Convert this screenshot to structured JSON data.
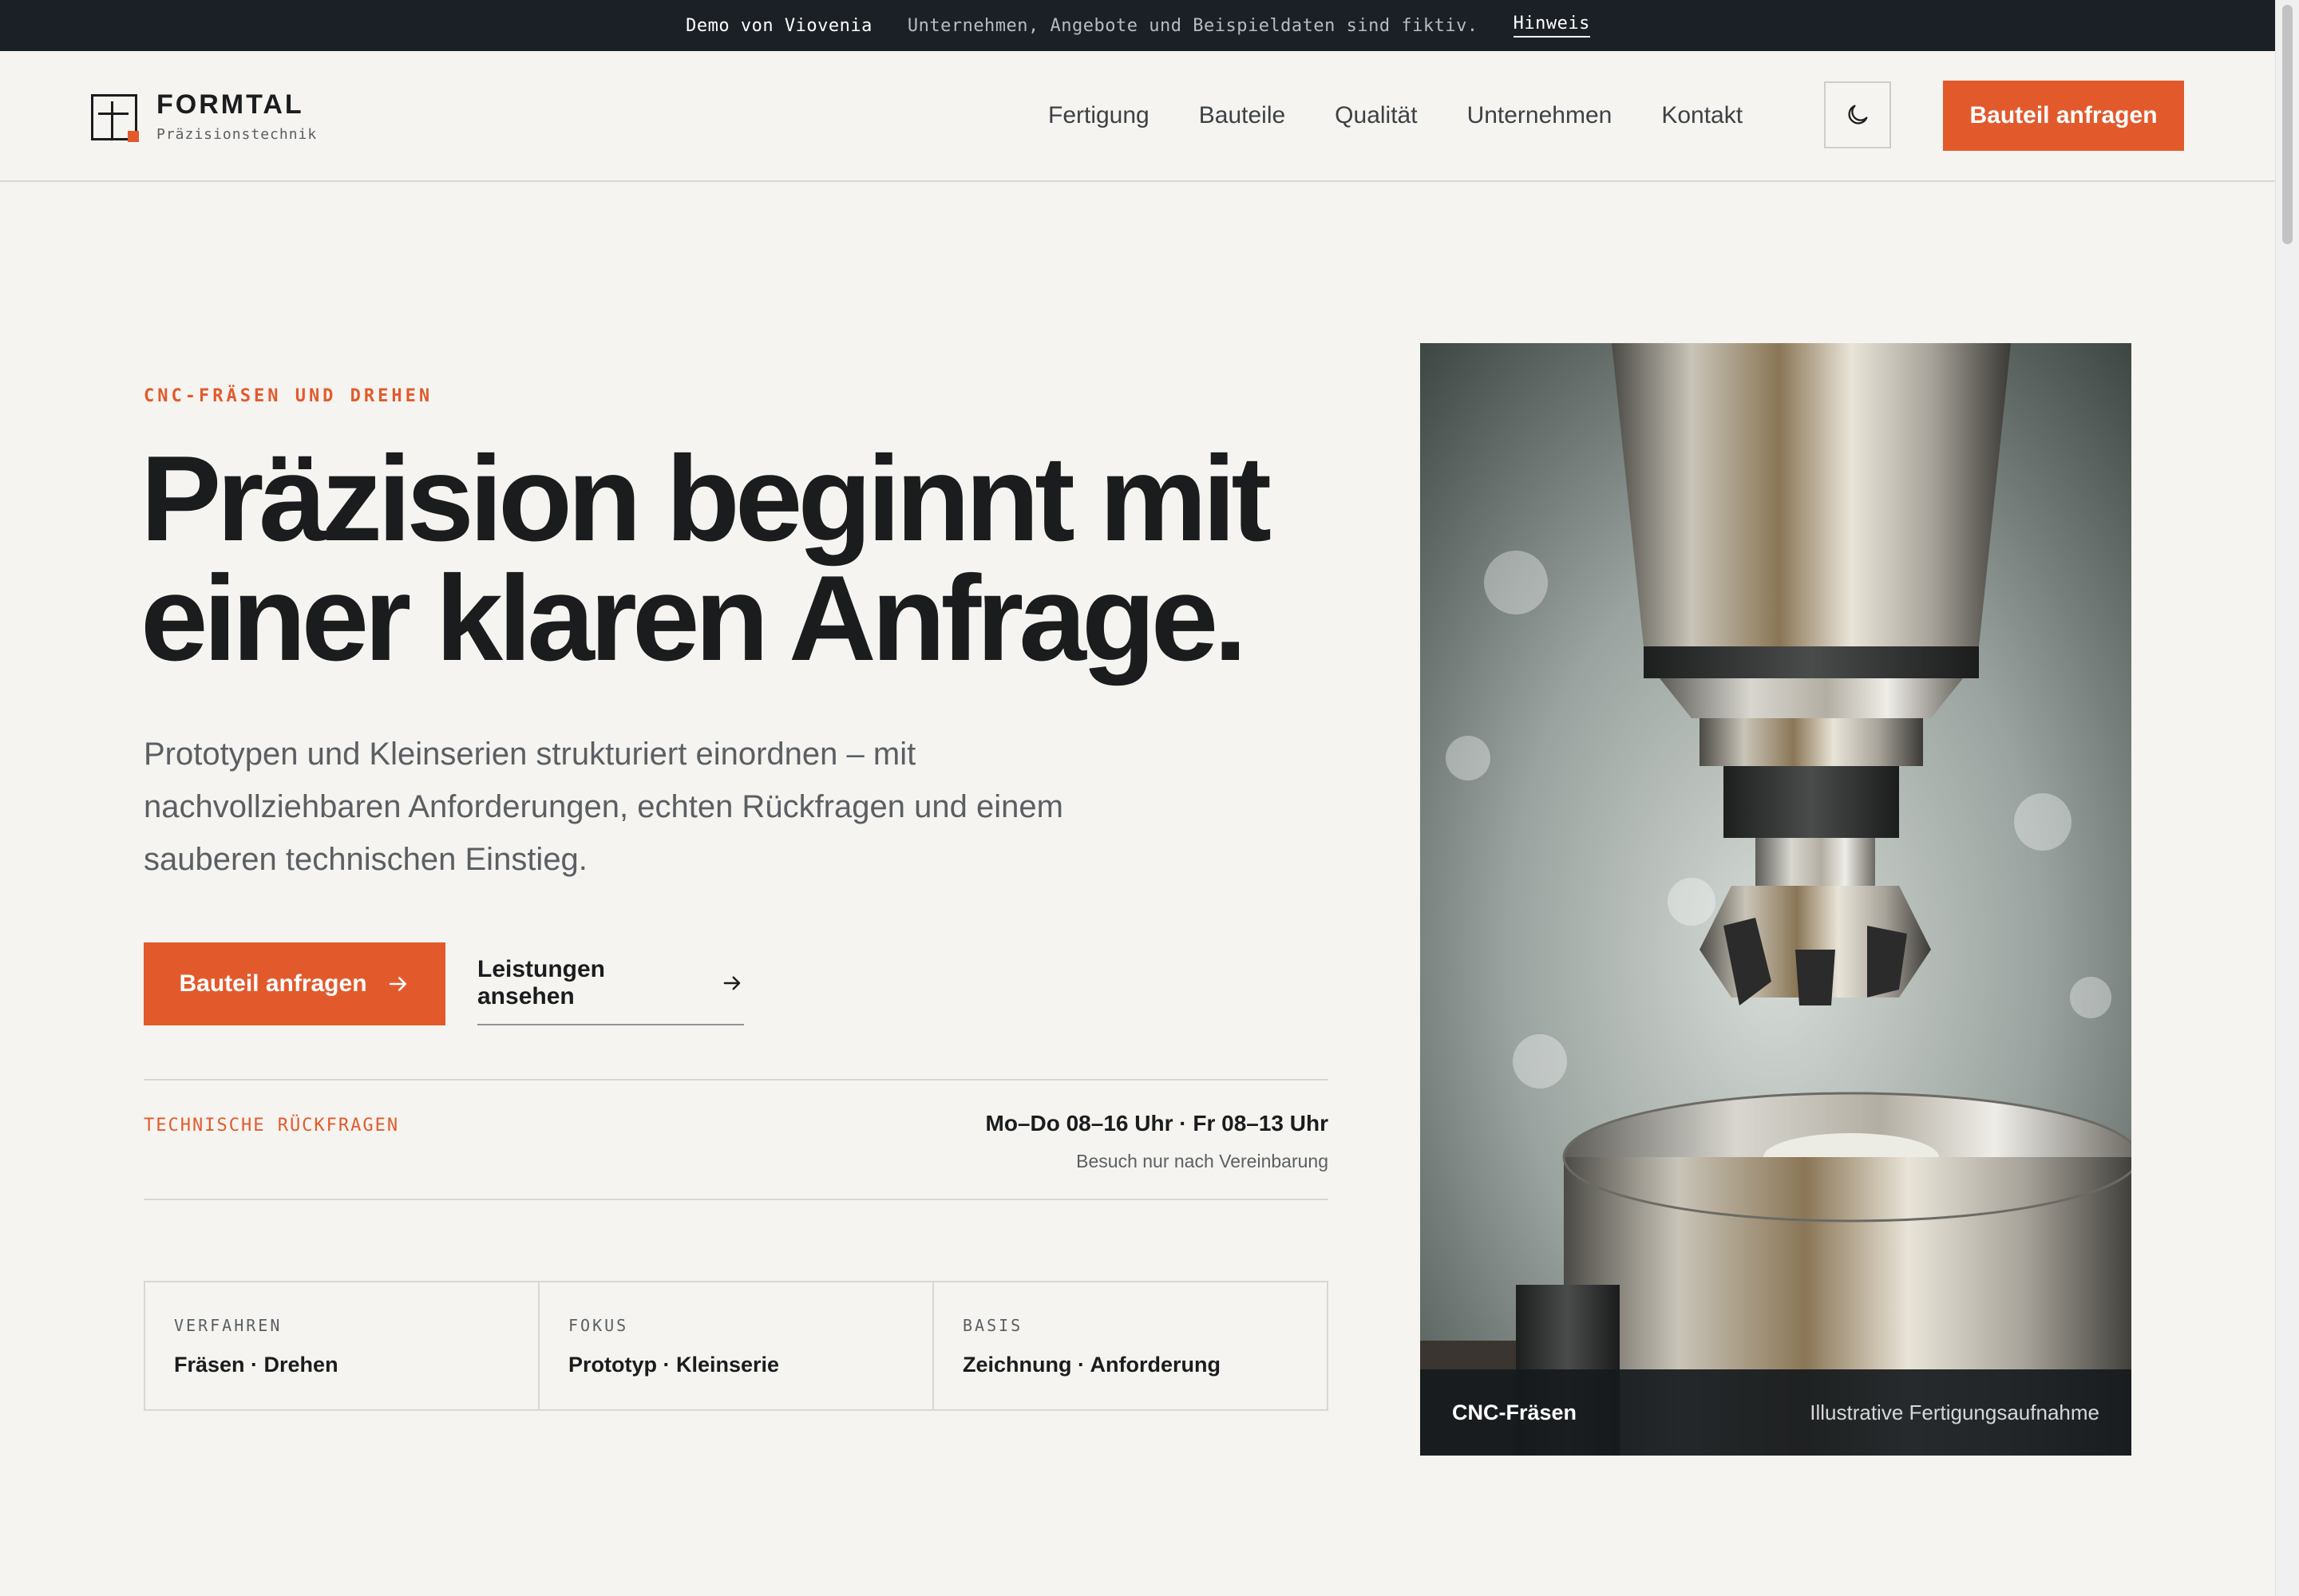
{
  "banner": {
    "brand": "Demo von Viovenia",
    "note": "Unternehmen, Angebote und Beispieldaten sind fiktiv.",
    "link": "Hinweis"
  },
  "header": {
    "logo_name": "FORMTAL",
    "logo_sub": "Präzisionstechnik",
    "nav": [
      "Fertigung",
      "Bauteile",
      "Qualität",
      "Unternehmen",
      "Kontakt"
    ],
    "theme_icon": "moon-icon",
    "cta": "Bauteil anfragen"
  },
  "hero": {
    "eyebrow": "CNC-FRÄSEN UND DREHEN",
    "title_line1": "Präzision beginnt mit",
    "title_line2": "einer klaren Anfrage.",
    "lead": "Prototypen und Kleinserien strukturiert einordnen – mit nachvollziehbaren Anforderungen, echten Rückfragen und einem sauberen technischen Einstieg.",
    "primary_button": "Bauteil anfragen",
    "secondary_button": "Leistungen ansehen"
  },
  "contact": {
    "label": "TECHNISCHE RÜCKFRAGEN",
    "hours": "Mo–Do 08–16 Uhr · Fr 08–13 Uhr",
    "note": "Besuch nur nach Vereinbarung"
  },
  "facts": [
    {
      "label": "VERFAHREN",
      "value": "Fräsen · Drehen"
    },
    {
      "label": "FOKUS",
      "value": "Prototyp · Kleinserie"
    },
    {
      "label": "BASIS",
      "value": "Zeichnung · Anforderung"
    }
  ],
  "figure": {
    "caption_title": "CNC-Fräsen",
    "caption_note": "Illustrative Fertigungsaufnahme"
  },
  "colors": {
    "accent": "#e25a2c",
    "banner_bg": "#1a2026",
    "page_bg": "#f5f4f0",
    "text": "#1a1c1e"
  }
}
